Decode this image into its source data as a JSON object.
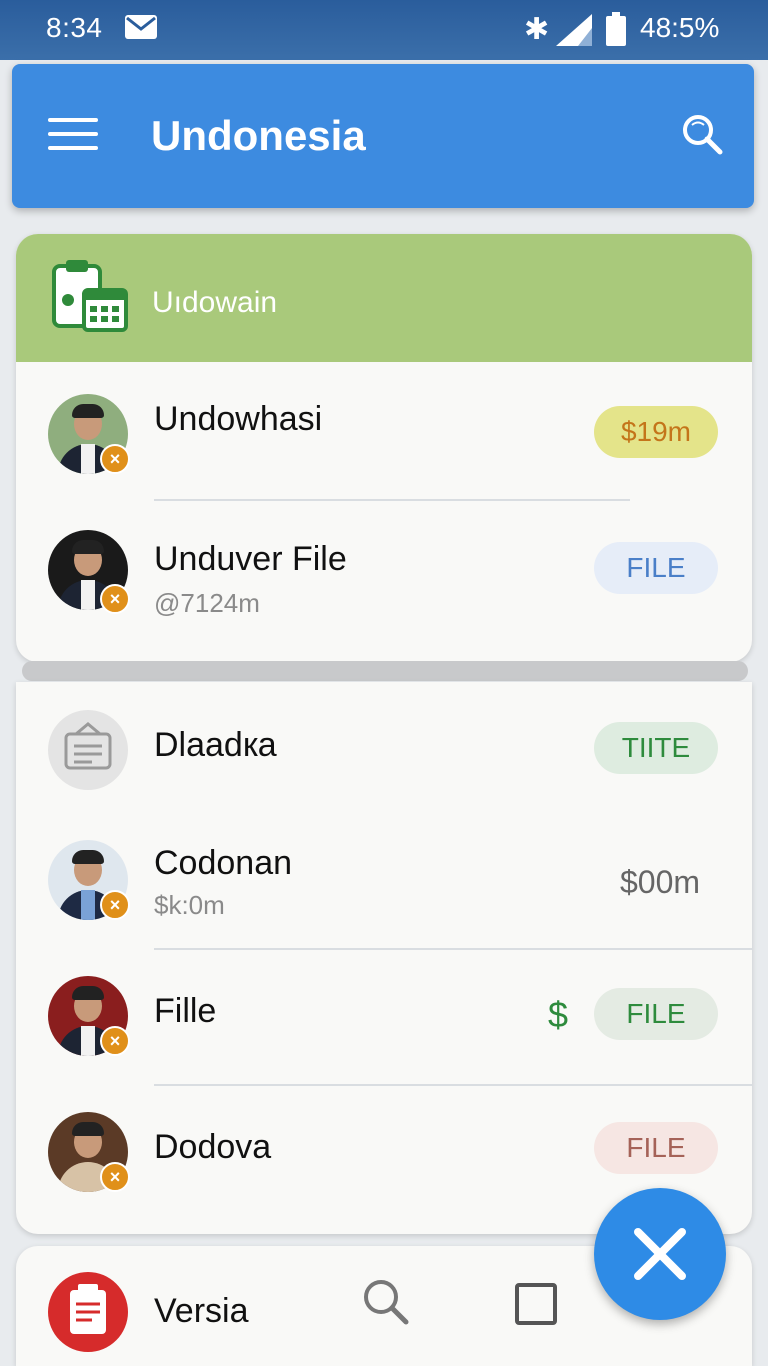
{
  "status_bar": {
    "time": "8:34",
    "battery_pct": "48:5%"
  },
  "app_bar": {
    "title": "Undonesia"
  },
  "card_header": {
    "title": "Uıdowain"
  },
  "items": [
    {
      "name": "Undowhasi",
      "sub": "",
      "tag": "$19m",
      "tag_color": "#e4e48a",
      "tag_text_color": "#c4751a"
    },
    {
      "name": "Unduver File",
      "sub": "@7124m",
      "tag": "FILE",
      "tag_color": "#e6edf8",
      "tag_text_color": "#4a7fc8"
    }
  ],
  "items2": [
    {
      "name": "Dlaadкa",
      "sub": "",
      "tag": "TIITE",
      "tag_color": "#deece0",
      "tag_text_color": "#2e8b3d"
    },
    {
      "name": "Codonan",
      "sub": "$k:0m",
      "value": "$00m"
    },
    {
      "name": "Fille",
      "sub": "",
      "dollar": "$",
      "tag": "FILE",
      "tag_color": "#e4ebe3",
      "tag_text_color": "#2e8b3d"
    },
    {
      "name": "Dodova",
      "sub": "",
      "tag": "FILE",
      "tag_color": "#f6e6e3",
      "tag_text_color": "#a56258"
    }
  ],
  "bottom": {
    "label": "Versia"
  },
  "icons": {
    "mail": "mail-icon",
    "bluetooth": "bluetooth-icon",
    "signal": "signal-icon",
    "battery": "battery-icon",
    "menu": "menu-icon",
    "search": "search-icon",
    "logo": "clipboard-calendar-icon",
    "task": "task-list-icon",
    "close": "close-icon",
    "square": "square-icon"
  },
  "colors": {
    "app_bar": "#3d8be0",
    "card_header": "#a9c97b",
    "fab": "#2e8be6",
    "badge": "#e0901a"
  }
}
